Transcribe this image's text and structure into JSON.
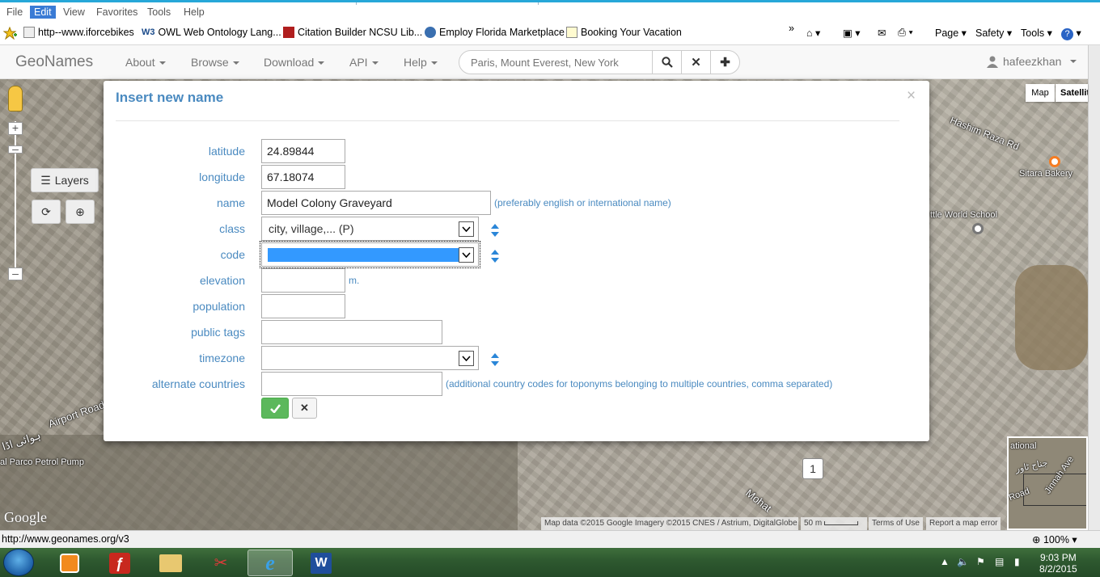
{
  "menubar": {
    "items": [
      "File",
      "Edit",
      "View",
      "Favorites",
      "Tools",
      "Help"
    ],
    "active": "Edit"
  },
  "favorites": {
    "items": [
      {
        "label": "http--www.iforcebikes",
        "icon": "page-icon"
      },
      {
        "label": "OWL Web Ontology Lang...",
        "icon": "w3c-icon"
      },
      {
        "label": "Citation Builder  NCSU Lib...",
        "icon": "library-icon"
      },
      {
        "label": "Employ Florida Marketplace",
        "icon": "globe-icon"
      },
      {
        "label": "Booking Your Vacation",
        "icon": "page-icon"
      }
    ],
    "more": "»",
    "commands": {
      "page": "Page",
      "safety": "Safety",
      "tools": "Tools"
    }
  },
  "navbar": {
    "brand": "GeoNames",
    "items": [
      "About",
      "Browse",
      "Download",
      "API",
      "Help"
    ],
    "search_placeholder": "Paris, Mount Everest, New York",
    "user": "hafeezkhan"
  },
  "map": {
    "layers_label": "Layers",
    "maptype": {
      "map": "Map",
      "satellite": "Satellite"
    },
    "labels": {
      "hashim": "Hashim Raza Rd",
      "sitara": "Sitara Bakery",
      "school": "ttle World School",
      "airport": "Airport Road",
      "urdu": "ہوائی اڈا",
      "parco": "al Parco Petrol Pump",
      "mohatta": "Mohat",
      "national": "ational",
      "jinnah": "Jinnah Ave",
      "road": "Road",
      "urdu2": "جناح ٹاور"
    },
    "cluster_count": "1",
    "google": "Google",
    "attribution": "Map data ©2015 Google Imagery ©2015 CNES / Astrium, DigitalGlobe",
    "scale": "50 m",
    "terms": "Terms of Use",
    "report": "Report a map error"
  },
  "modal": {
    "title": "Insert new name",
    "close": "×",
    "fields": {
      "latitude": {
        "label": "latitude",
        "value": "24.89844"
      },
      "longitude": {
        "label": "longitude",
        "value": "67.18074"
      },
      "name": {
        "label": "name",
        "value": "Model Colony Graveyard",
        "hint": "(preferably english or international name)"
      },
      "class": {
        "label": "class",
        "value": "city, village,... (P)"
      },
      "code": {
        "label": "code",
        "value": ""
      },
      "elevation": {
        "label": "elevation",
        "value": "",
        "unit": "m."
      },
      "population": {
        "label": "population",
        "value": ""
      },
      "public_tags": {
        "label": "public tags",
        "value": ""
      },
      "timezone": {
        "label": "timezone",
        "value": ""
      },
      "alternate_countries": {
        "label": "alternate countries",
        "value": "",
        "hint": "(additional country codes for toponyms belonging to multiple countries, comma separated)"
      }
    }
  },
  "statusbar": {
    "url": "http://www.geonames.org/v3",
    "zoom": "100%"
  },
  "taskbar": {
    "time": "9:03 PM",
    "date": "8/2/2015"
  },
  "colors": {
    "accent": "#4a8ac0",
    "ok": "#5cb85c",
    "selection": "#3399ff"
  }
}
